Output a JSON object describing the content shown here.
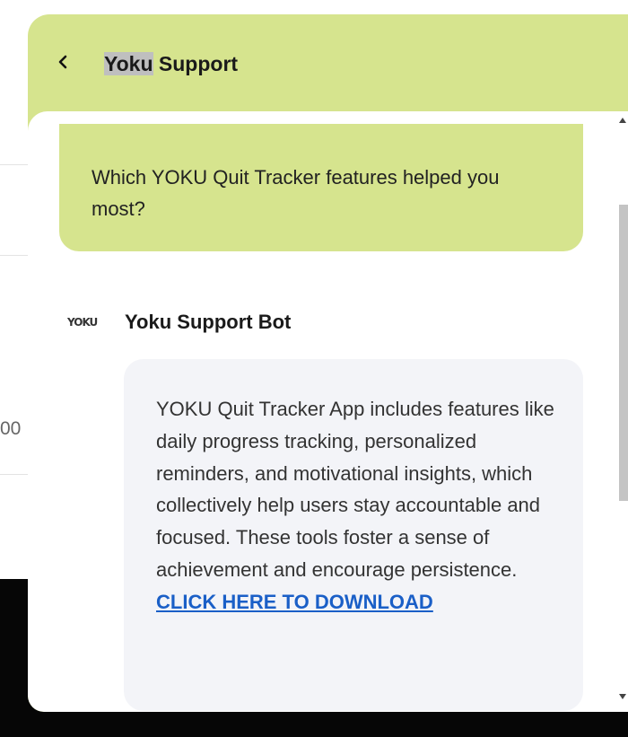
{
  "background": {
    "partial_value": "00"
  },
  "header": {
    "back_icon": "chevron-left-icon",
    "title_highlighted": "Yoku",
    "title_rest": " Support"
  },
  "question": {
    "text": "Which YOKU Quit Tracker features helped you most?"
  },
  "bot": {
    "logo_text": "YOKU",
    "name": "Yoku Support Bot"
  },
  "answer": {
    "text": "YOKU Quit Tracker App includes features like daily progress tracking, personalized reminders, and motivational insights, which collectively help users stay accountable and focused. These tools foster a sense of achievement and encourage persistence.",
    "link_text": "CLICK HERE TO DOWNLOAD"
  },
  "colors": {
    "accent": "#d6e48e",
    "link": "#1a5fc7",
    "bubble": "#f3f4f8"
  }
}
